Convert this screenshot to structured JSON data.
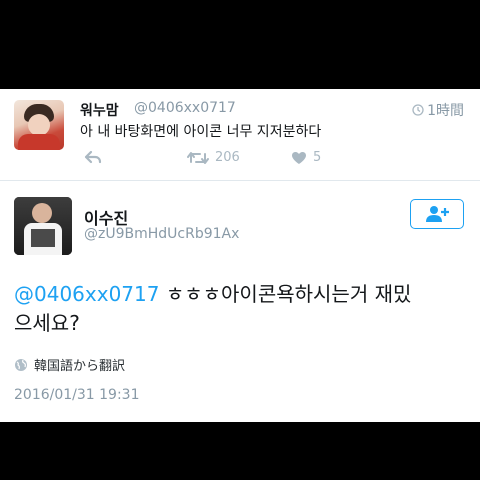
{
  "tweet1": {
    "name": "워누맘",
    "handle": "@0406xx0717",
    "time": "1時間",
    "text": "아 내 바탕화면에 아이콘 너무 지저분하다",
    "retweets": "206",
    "likes": "5"
  },
  "tweet2": {
    "name": "이수진",
    "handle": "@zU9BmHdUcRb91Ax",
    "mention": "@0406xx0717",
    "text_line1": " ㅎㅎㅎ아이콘욕하시는거 재밌",
    "text_line2": "으세요?",
    "translate_label": "韓国語から翻訳",
    "date": "2016/01/31 19:31"
  },
  "colors": {
    "accent": "#1da1f2",
    "muted": "#8899a6",
    "text": "#14171a",
    "background": "#000000"
  },
  "icons": [
    "clock-icon",
    "reply-icon",
    "retweet-icon",
    "heart-icon",
    "follow-user-icon",
    "globe-icon"
  ]
}
